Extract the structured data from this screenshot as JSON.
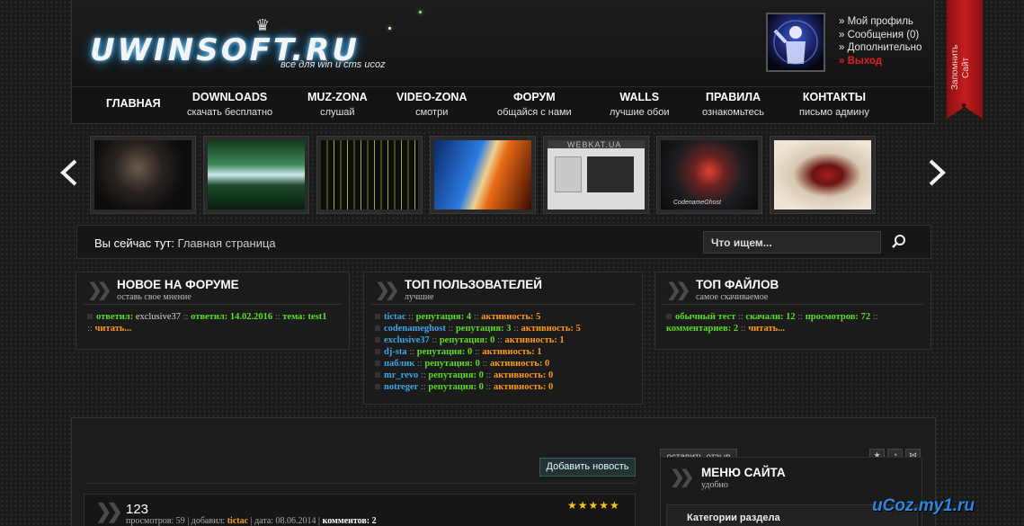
{
  "header": {
    "logo_text": "UWINSOFT.RU",
    "logo_tagline": "все для win и cms ucoz",
    "user_menu": [
      "» Мой профиль",
      "» Сообщения (0)",
      "» Дополнительно"
    ],
    "logout": "» Выход"
  },
  "nav": [
    {
      "title": "ГЛАВНАЯ",
      "sub": ""
    },
    {
      "title": "DOWNLOADS",
      "sub": "скачать бесплатно"
    },
    {
      "title": "MUZ-ZONA",
      "sub": "слушай"
    },
    {
      "title": "VIDEO-ZONA",
      "sub": "смотри"
    },
    {
      "title": "ФОРУМ",
      "sub": "общайся с нами"
    },
    {
      "title": "WALLS",
      "sub": "лучшие обои"
    },
    {
      "title": "ПРАВИЛА",
      "sub": "ознакомьтесь"
    },
    {
      "title": "КОНТАКТЫ",
      "sub": "письмо админу"
    }
  ],
  "ribbon": {
    "label": "Запомнить Сайт"
  },
  "slider": {
    "thumbs": [
      {
        "icon": "photo-hacker"
      },
      {
        "icon": "photo-waterfall"
      },
      {
        "icon": "photo-city-lights"
      },
      {
        "icon": "photo-fire-ice"
      },
      {
        "icon": "photo-webkat",
        "caption": "WEBKAT.UA"
      },
      {
        "icon": "photo-skull",
        "caption": "CodenameGhost"
      },
      {
        "icon": "photo-girl"
      }
    ]
  },
  "search": {
    "breadcrumb_label": "Вы сейчас тут:",
    "breadcrumb_current": "Главная страница",
    "placeholder": "Что ищем..."
  },
  "forum_panel": {
    "title": "НОВОЕ НА ФОРУМЕ",
    "sub": "оставь свое мнение",
    "k1": "ответил:",
    "v1": "exclusive37",
    "k2": "ответил:",
    "v2": "14.02.2016",
    "k3": "тема:",
    "v3": "test1",
    "read": "читать..."
  },
  "top_users": {
    "title": "ТОП ПОЛЬЗОВАТЕЛЕЙ",
    "sub": "лучшие",
    "rep_label": "репутация:",
    "act_label": "активность:",
    "users": [
      {
        "name": "tictac",
        "rep": "4",
        "act": "5"
      },
      {
        "name": "codenameghost",
        "rep": "3",
        "act": "5"
      },
      {
        "name": "exclusive37",
        "rep": "0",
        "act": "1"
      },
      {
        "name": "dj-sta",
        "rep": "0",
        "act": "1"
      },
      {
        "name": "паблик",
        "rep": "0",
        "act": "0"
      },
      {
        "name": "mr_revo",
        "rep": "0",
        "act": "0"
      },
      {
        "name": "notreger",
        "rep": "0",
        "act": "0"
      }
    ]
  },
  "top_files": {
    "title": "ТОП ФАЙЛОВ",
    "sub": "самое скачиваемое",
    "file": "обычный тест",
    "k1": "скачали:",
    "v1": "12",
    "k2": "просмотров:",
    "v2": "72",
    "k3": "комментариев:",
    "v3": "2",
    "read": "читать..."
  },
  "main": {
    "add_news": "Добавить новость",
    "leave_review": "оставить отзыв",
    "post": {
      "title": "123",
      "views_label": "просмотров:",
      "views": "59",
      "added_label": "добавил:",
      "author": "tictac",
      "date_label": "дата:",
      "date": "08.06.2014",
      "comments_label": "комментов:",
      "comments": "2",
      "rating": "★★★★★"
    }
  },
  "site_menu": {
    "title": "МЕНЮ САЙТА",
    "sub": "удобно",
    "category": "Категории раздела"
  },
  "watermark": "uCoz.my1.ru"
}
